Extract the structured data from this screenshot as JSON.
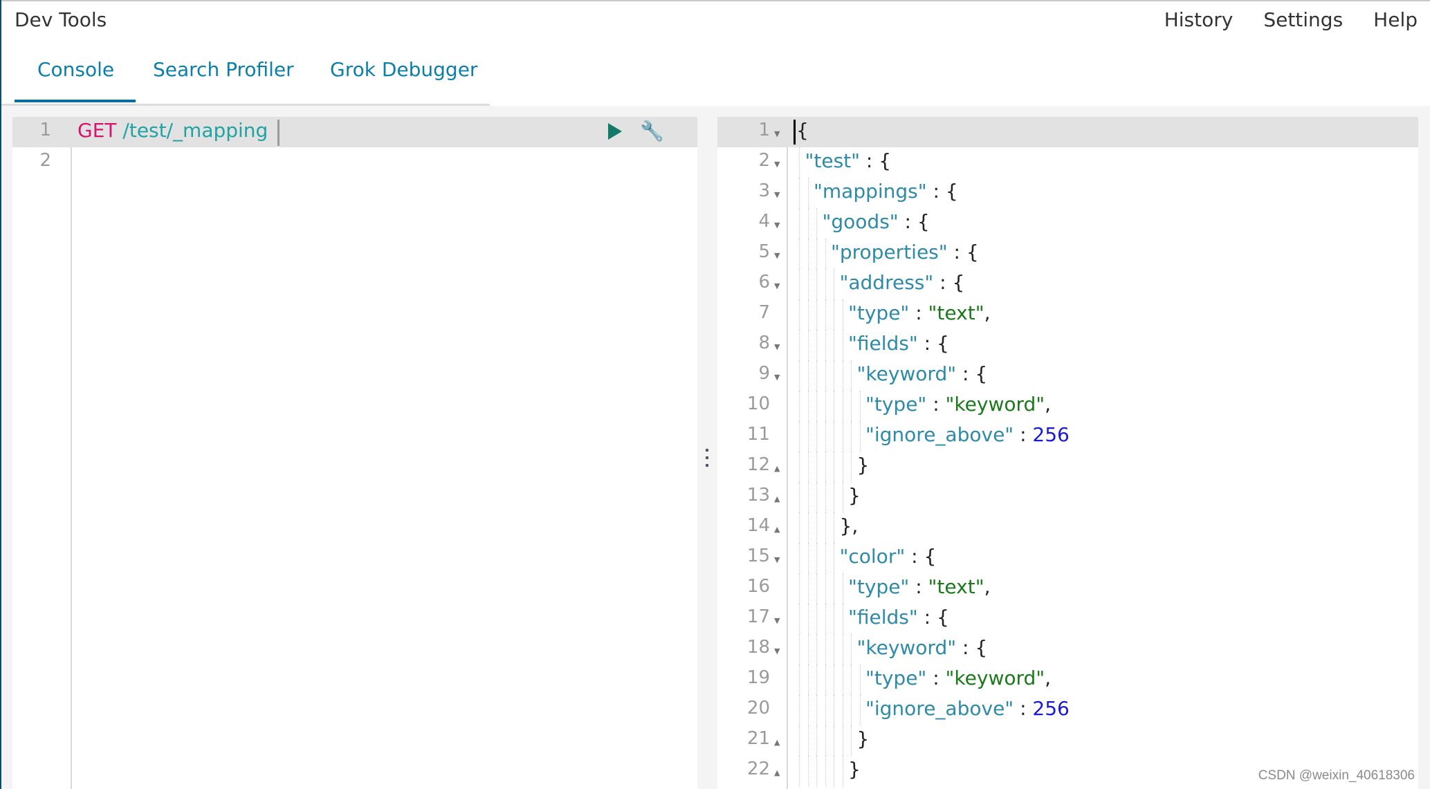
{
  "app": {
    "title": "Dev Tools"
  },
  "top_nav": [
    {
      "label": "History"
    },
    {
      "label": "Settings"
    },
    {
      "label": "Help"
    }
  ],
  "tabs": [
    {
      "label": "Console",
      "active": true
    },
    {
      "label": "Search Profiler",
      "active": false
    },
    {
      "label": "Grok Debugger",
      "active": false
    }
  ],
  "request_editor": {
    "lines": [
      {
        "n": "1",
        "method": "GET",
        "path": " /test/_mapping"
      },
      {
        "n": "2",
        "method": "",
        "path": ""
      }
    ],
    "actions": {
      "run_icon": "play-icon",
      "settings_icon": "wrench-icon"
    }
  },
  "response_editor": {
    "lines": [
      {
        "n": "1",
        "fold": "down",
        "indent": 0,
        "tokens": [
          [
            "punc",
            "{"
          ]
        ]
      },
      {
        "n": "2",
        "fold": "down",
        "indent": 1,
        "tokens": [
          [
            "key",
            "\"test\""
          ],
          [
            "punc",
            " : {"
          ]
        ]
      },
      {
        "n": "3",
        "fold": "down",
        "indent": 2,
        "tokens": [
          [
            "key",
            "\"mappings\""
          ],
          [
            "punc",
            " : {"
          ]
        ]
      },
      {
        "n": "4",
        "fold": "down",
        "indent": 3,
        "tokens": [
          [
            "key",
            "\"goods\""
          ],
          [
            "punc",
            " : {"
          ]
        ]
      },
      {
        "n": "5",
        "fold": "down",
        "indent": 4,
        "tokens": [
          [
            "key",
            "\"properties\""
          ],
          [
            "punc",
            " : {"
          ]
        ]
      },
      {
        "n": "6",
        "fold": "down",
        "indent": 5,
        "tokens": [
          [
            "key",
            "\"address\""
          ],
          [
            "punc",
            " : {"
          ]
        ]
      },
      {
        "n": "7",
        "fold": "",
        "indent": 6,
        "tokens": [
          [
            "key",
            "\"type\""
          ],
          [
            "punc",
            " : "
          ],
          [
            "str",
            "\"text\""
          ],
          [
            "punc",
            ","
          ]
        ]
      },
      {
        "n": "8",
        "fold": "down",
        "indent": 6,
        "tokens": [
          [
            "key",
            "\"fields\""
          ],
          [
            "punc",
            " : {"
          ]
        ]
      },
      {
        "n": "9",
        "fold": "down",
        "indent": 7,
        "tokens": [
          [
            "key",
            "\"keyword\""
          ],
          [
            "punc",
            " : {"
          ]
        ]
      },
      {
        "n": "10",
        "fold": "",
        "indent": 8,
        "tokens": [
          [
            "key",
            "\"type\""
          ],
          [
            "punc",
            " : "
          ],
          [
            "str",
            "\"keyword\""
          ],
          [
            "punc",
            ","
          ]
        ]
      },
      {
        "n": "11",
        "fold": "",
        "indent": 8,
        "tokens": [
          [
            "key",
            "\"ignore_above\""
          ],
          [
            "punc",
            " : "
          ],
          [
            "num",
            "256"
          ]
        ]
      },
      {
        "n": "12",
        "fold": "up",
        "indent": 7,
        "tokens": [
          [
            "punc",
            "}"
          ]
        ]
      },
      {
        "n": "13",
        "fold": "up",
        "indent": 6,
        "tokens": [
          [
            "punc",
            "}"
          ]
        ]
      },
      {
        "n": "14",
        "fold": "up",
        "indent": 5,
        "tokens": [
          [
            "punc",
            "},"
          ]
        ]
      },
      {
        "n": "15",
        "fold": "down",
        "indent": 5,
        "tokens": [
          [
            "key",
            "\"color\""
          ],
          [
            "punc",
            " : {"
          ]
        ]
      },
      {
        "n": "16",
        "fold": "",
        "indent": 6,
        "tokens": [
          [
            "key",
            "\"type\""
          ],
          [
            "punc",
            " : "
          ],
          [
            "str",
            "\"text\""
          ],
          [
            "punc",
            ","
          ]
        ]
      },
      {
        "n": "17",
        "fold": "down",
        "indent": 6,
        "tokens": [
          [
            "key",
            "\"fields\""
          ],
          [
            "punc",
            " : {"
          ]
        ]
      },
      {
        "n": "18",
        "fold": "down",
        "indent": 7,
        "tokens": [
          [
            "key",
            "\"keyword\""
          ],
          [
            "punc",
            " : {"
          ]
        ]
      },
      {
        "n": "19",
        "fold": "",
        "indent": 8,
        "tokens": [
          [
            "key",
            "\"type\""
          ],
          [
            "punc",
            " : "
          ],
          [
            "str",
            "\"keyword\""
          ],
          [
            "punc",
            ","
          ]
        ]
      },
      {
        "n": "20",
        "fold": "",
        "indent": 8,
        "tokens": [
          [
            "key",
            "\"ignore_above\""
          ],
          [
            "punc",
            " : "
          ],
          [
            "num",
            "256"
          ]
        ]
      },
      {
        "n": "21",
        "fold": "up",
        "indent": 7,
        "tokens": [
          [
            "punc",
            "}"
          ]
        ]
      },
      {
        "n": "22",
        "fold": "up",
        "indent": 6,
        "tokens": [
          [
            "punc",
            "}"
          ]
        ]
      }
    ]
  },
  "watermark": "CSDN @weixin_40618306"
}
